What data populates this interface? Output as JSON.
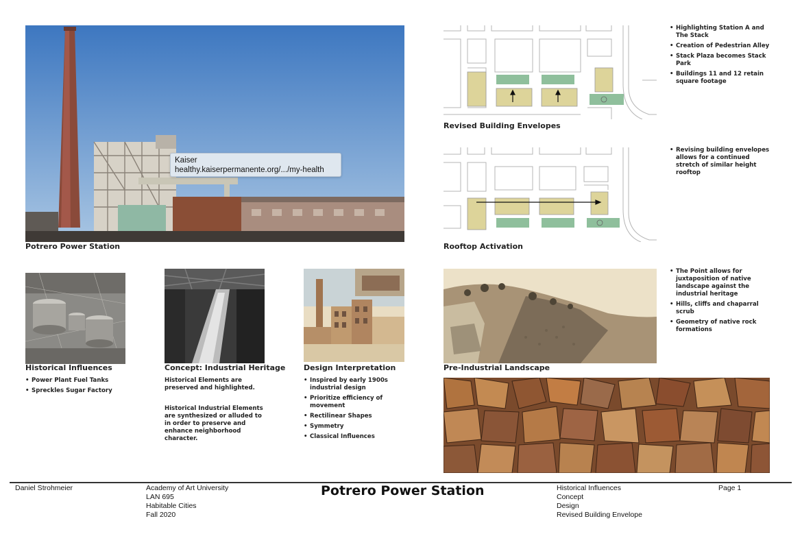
{
  "panels": {
    "power_station": {
      "caption": "Potrero Power Station"
    },
    "revised_envelopes": {
      "caption": "Revised Building Envelopes",
      "bullets": [
        "Highlighting Station A and The Stack",
        "Creation of Pedestrian Alley",
        "Stack Plaza becomes Stack Park",
        "Buildings 11 and 12 retain square footage"
      ]
    },
    "rooftop": {
      "caption": "Rooftop Activation",
      "bullets": [
        "Revising building envelopes allows for a continued stretch of similar height rooftop"
      ]
    },
    "historical": {
      "caption": "Historical Influences",
      "bullets": [
        "Power Plant Fuel Tanks",
        "Spreckles Sugar Factory"
      ]
    },
    "concept": {
      "caption": "Concept: Industrial Heritage",
      "para1": "Historical Elements are preserved and highlighted.",
      "para2": "Historical Industrial Elements are synthesized or alluded to in order to preserve and enhance neighborhood character."
    },
    "design": {
      "caption": "Design Interpretation",
      "bullets": [
        "Inspired by early 1900s industrial design",
        "Prioritize efficiency of movement",
        "Rectilinear Shapes",
        "Symmetry",
        "Classical Influences"
      ]
    },
    "landscape": {
      "caption": "Pre-Industrial Landscape",
      "bullets": [
        "The Point allows for juxtaposition of native landscape against the industrial heritage",
        "Hills, cliffs and chaparral scrub",
        "Geometry of native rock formations"
      ]
    }
  },
  "tooltip": {
    "line1": "Kaiser",
    "line2": "healthy.kaiserpermanente.org/.../my-health"
  },
  "footer": {
    "author": "Daniel Strohmeier",
    "school": [
      "Academy of Art University",
      "LAN 695",
      "Habitable Cities",
      "Fall 2020"
    ],
    "title": "Potrero Power Station",
    "sections": [
      "Historical Influences",
      "Concept",
      "Design",
      "Revised Building Envelope"
    ],
    "page": "Page 1"
  },
  "colors": {
    "sky": "#4f86c6",
    "building_yellow": "#ddd49a",
    "green_strip": "#8fbf9c",
    "rock": "#9c5a2c"
  }
}
